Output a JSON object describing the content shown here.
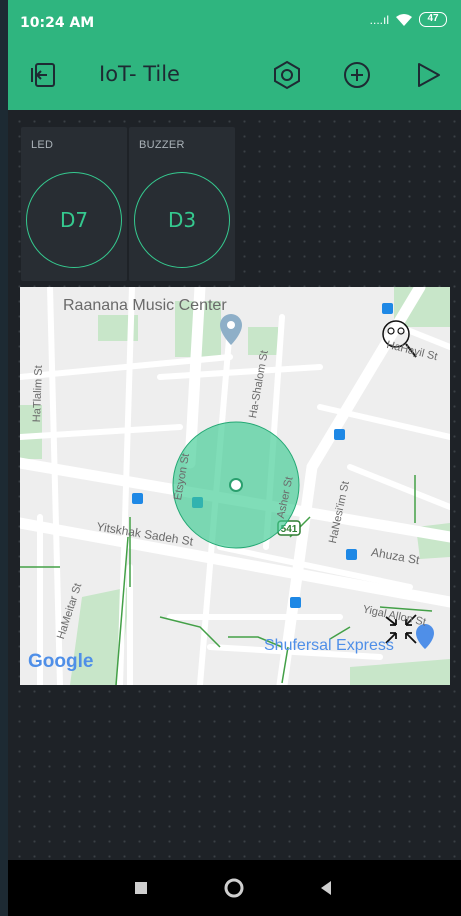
{
  "status_bar": {
    "time": "10:24 AM",
    "signal": "....ıl",
    "battery": "47"
  },
  "toolbar": {
    "title": "IoT- Tile"
  },
  "tiles": [
    {
      "label": "LED",
      "pin": "D7"
    },
    {
      "label": "BUZZER",
      "pin": "D3"
    }
  ],
  "map": {
    "poi_title": "Raanana Music Center",
    "poi_store": "Shufersal Express",
    "streets": [
      "HaTlalim St",
      "Ha-Shalom St",
      "HaHayil St",
      "Etsyon St",
      "Asher St",
      "HaNesi'im St",
      "Yitskhak Sadeh St",
      "Ahuza St",
      "HaMeitar St",
      "Yigal Allon St"
    ],
    "road_badge": "541",
    "attribution": "Google"
  },
  "colors": {
    "accent": "#2fb57f",
    "tile_ring": "#35c98f",
    "canvas": "#1e2227",
    "tile": "#282d33"
  }
}
